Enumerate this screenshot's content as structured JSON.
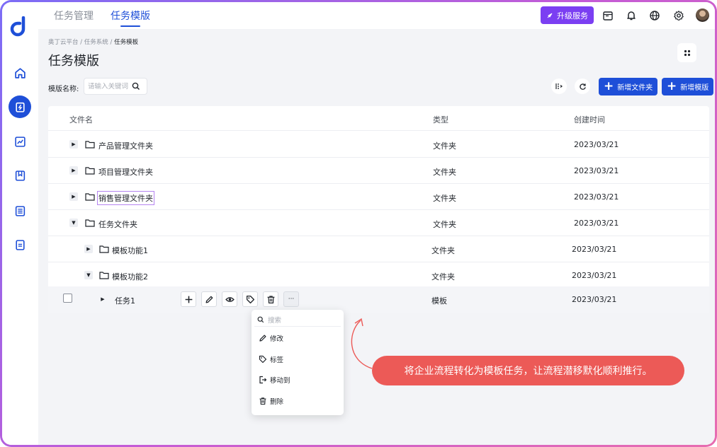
{
  "topnav": {
    "items": [
      {
        "label": "任务管理",
        "active": false
      },
      {
        "label": "任务模版",
        "active": true
      }
    ]
  },
  "topbar": {
    "upgrade_label": "升级服务"
  },
  "breadcrumb": {
    "items": [
      "奥丁云平台",
      "任务系统",
      "任务模板"
    ]
  },
  "page": {
    "title": "任务模版"
  },
  "filter": {
    "label": "模版名称:",
    "placeholder": "请输入关键词"
  },
  "toolbar": {
    "new_folder": "新增文件夹",
    "new_template": "新增模版"
  },
  "table": {
    "columns": [
      "文件名",
      "类型",
      "创建时间"
    ],
    "rows": [
      {
        "name": "产品管理文件夹",
        "type": "文件夹",
        "date": "2023/03/21",
        "expanded": false
      },
      {
        "name": "项目管理文件夹",
        "type": "文件夹",
        "date": "2023/03/21",
        "expanded": false
      },
      {
        "name": "销售管理文件夹",
        "type": "文件夹",
        "date": "2023/03/21",
        "expanded": false
      },
      {
        "name": "任务文件夹",
        "type": "文件夹",
        "date": "2023/03/21",
        "expanded": true
      },
      {
        "name": "模板功能1",
        "type": "文件夹",
        "date": "2023/03/21",
        "expanded": false
      },
      {
        "name": "模板功能2",
        "type": "文件夹",
        "date": "2023/03/21",
        "expanded": true
      },
      {
        "name": "任务1",
        "type": "模板",
        "date": "2023/03/21",
        "expanded": false
      }
    ]
  },
  "row_actions": {
    "more_label": "···"
  },
  "dropdown": {
    "search_placeholder": "搜索",
    "items": [
      {
        "label": "修改",
        "icon": "pencil-icon"
      },
      {
        "label": "标签",
        "icon": "tag-icon"
      },
      {
        "label": "移动到",
        "icon": "move-icon"
      },
      {
        "label": "删除",
        "icon": "trash-icon"
      }
    ]
  },
  "callout": {
    "text": "将企业流程转化为模板任务，让流程潜移默化顺利推行。"
  },
  "colors": {
    "primary": "#1e4fd8",
    "upgrade": "#7b3ff2",
    "callout": "#ec5a57"
  }
}
